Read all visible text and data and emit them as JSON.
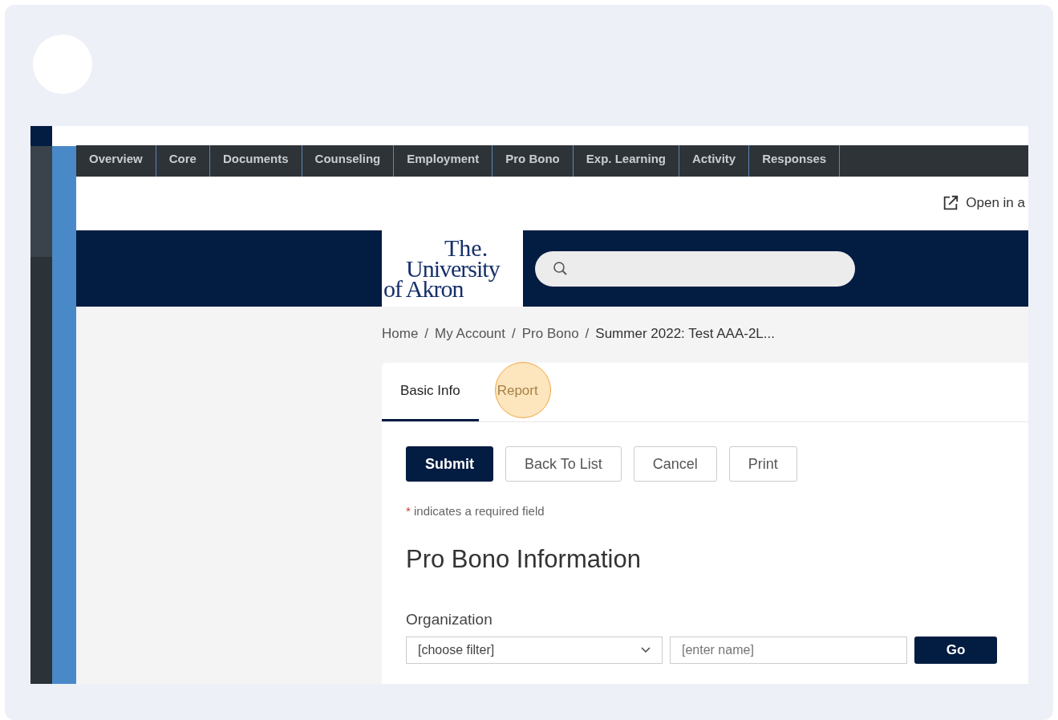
{
  "nav_tabs": [
    {
      "label": "Overview"
    },
    {
      "label": "Core"
    },
    {
      "label": "Documents"
    },
    {
      "label": "Counseling"
    },
    {
      "label": "Employment"
    },
    {
      "label": "Pro Bono"
    },
    {
      "label": "Exp. Learning"
    },
    {
      "label": "Activity"
    },
    {
      "label": "Responses"
    }
  ],
  "open_link": "Open in a",
  "logo": {
    "line1": "The.",
    "line2": "University",
    "line3": "of Akron"
  },
  "breadcrumb": [
    "Home",
    "My Account",
    "Pro Bono",
    "Summer 2022: Test AAA-2L..."
  ],
  "breadcrumb_separator": "/",
  "tabs": [
    {
      "label": "Basic Info",
      "selected": true
    },
    {
      "label": "Report",
      "selected": false,
      "highlighted": true
    }
  ],
  "buttons": [
    {
      "label": "Submit",
      "kind": "primary"
    },
    {
      "label": "Back To List",
      "kind": "secondary"
    },
    {
      "label": "Cancel",
      "kind": "secondary"
    },
    {
      "label": "Print",
      "kind": "secondary"
    }
  ],
  "required_note": {
    "mark": "*",
    "text": "indicates a required field"
  },
  "section_title": "Pro Bono Information",
  "organization": {
    "label": "Organization",
    "filter_placeholder": "[choose filter]",
    "name_placeholder": "[enter name]",
    "go": "Go"
  }
}
